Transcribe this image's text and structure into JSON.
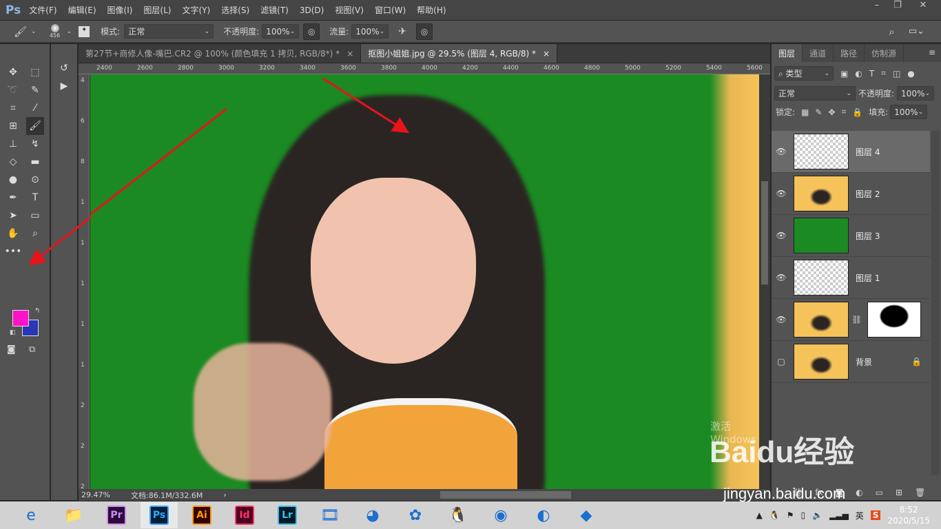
{
  "app": {
    "logo": "Ps"
  },
  "menu": [
    "文件(F)",
    "编辑(E)",
    "图像(I)",
    "图层(L)",
    "文字(Y)",
    "选择(S)",
    "滤镜(T)",
    "3D(D)",
    "视图(V)",
    "窗口(W)",
    "帮助(H)"
  ],
  "window_controls": [
    "–",
    "❐",
    "✕"
  ],
  "options": {
    "brush_size": "456",
    "mode_label": "模式:",
    "mode_value": "正常",
    "opacity_label": "不透明度:",
    "opacity_value": "100%",
    "flow_label": "流量:",
    "flow_value": "100%"
  },
  "tabs": [
    {
      "label": "第27节+商修人像-嘴巴.CR2 @ 100% (颜色填充 1 拷贝, RGB/8*) *",
      "close": "×"
    },
    {
      "label": "抠图小姐姐.jpg @ 29.5% (图层 4, RGB/8) *",
      "close": "×"
    }
  ],
  "ruler_x": [
    "2400",
    "2600",
    "2800",
    "3000",
    "3200",
    "3400",
    "3600",
    "3800",
    "4000",
    "4200",
    "4400",
    "4600",
    "4800",
    "5000",
    "5200",
    "5400",
    "5600"
  ],
  "ruler_y": [
    "4",
    "6",
    "8",
    "1",
    "1",
    "1",
    "1",
    "1",
    "2",
    "2",
    "2"
  ],
  "colors": {
    "foreground": "#ff13c8",
    "background": "#2b35b8",
    "canvas_bg": "#1b8a22",
    "photo_bg": "#f6c25a",
    "arrow": "#e8141a"
  },
  "status": {
    "zoom": "29.47%",
    "doc": "文档:86.1M/332.6M"
  },
  "layers_panel": {
    "tabs": [
      "图层",
      "通道",
      "路径",
      "仿制源"
    ],
    "filter": "类型",
    "blend": "正常",
    "opacity_label": "不透明度:",
    "opacity": "100%",
    "lock_label": "锁定:",
    "fill_label": "填充:",
    "fill": "100%",
    "layers": [
      {
        "name": "图层 4",
        "visible": true,
        "selected": true,
        "thumb": "transparent"
      },
      {
        "name": "图层 2",
        "visible": true,
        "selected": false,
        "thumb": "photo"
      },
      {
        "name": "图层 3",
        "visible": true,
        "selected": false,
        "thumb": "green"
      },
      {
        "name": "图层 1",
        "visible": true,
        "selected": false,
        "thumb": "cutout"
      },
      {
        "name": "",
        "visible": true,
        "selected": false,
        "thumb": "photo",
        "mask": true
      },
      {
        "name": "背景",
        "visible": false,
        "selected": false,
        "thumb": "photo",
        "locked": true
      }
    ]
  },
  "watermark": {
    "text": "Baidu经验",
    "url": "jingyan.baidu.com",
    "activate": "激活 Windows"
  },
  "taskbar": {
    "apps": [
      "ie",
      "explorer",
      "Pr",
      "Ps",
      "Ai",
      "Id",
      "Lr",
      "video",
      "app-green",
      "app-bird",
      "qq",
      "chrome",
      "app-fox",
      "app-blue"
    ],
    "ime": "英",
    "time": "8:52",
    "date": "2020/5/15"
  }
}
